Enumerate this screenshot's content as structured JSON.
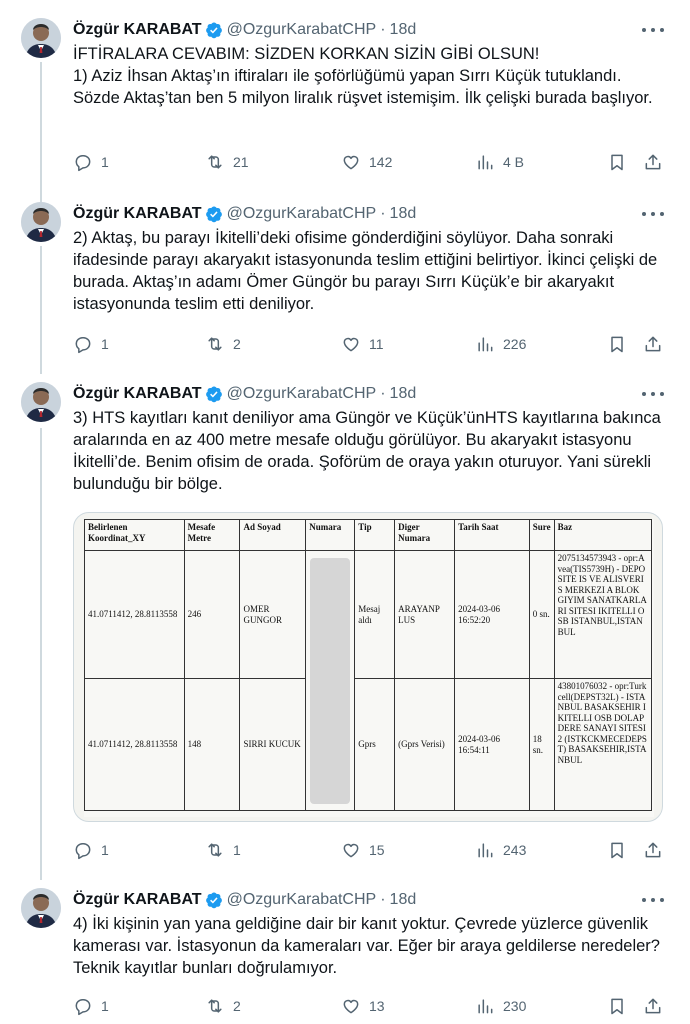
{
  "user": {
    "name": "Özgür KARABAT",
    "handle": "@OzgurKarabatCHP",
    "separator": "·",
    "time": "18d"
  },
  "tweets": [
    {
      "lines": [
        "İFTİRALARA CEVABIM: SİZDEN KORKAN SİZİN GİBİ OLSUN!",
        "1) Aziz İhsan Aktaş’ın iftiraları ile şoförlüğümü yapan Sırrı Küçük tutuklandı. Sözde Aktaş’tan ben 5 milyon liralık rüşvet istemişim. İlk çelişki burada başlıyor."
      ],
      "replies": "1",
      "retweets": "21",
      "likes": "142",
      "views": "4 B"
    },
    {
      "lines": [
        "2) Aktaş, bu parayı İkitelli’deki ofisime gönderdiğini söylüyor. Daha sonraki ifadesinde parayı akaryakıt istasyonunda teslim ettiğini belirtiyor. İkinci çelişki de burada. Aktaş’ın adamı Ömer Güngör bu parayı Sırrı Küçük’e bir akaryakıt istasyonunda teslim etti deniliyor."
      ],
      "replies": "1",
      "retweets": "2",
      "likes": "11",
      "views": "226"
    },
    {
      "lines": [
        "3) HTS kayıtları kanıt deniliyor ama Güngör ve Küçük’ünHTS kayıtlarına bakınca aralarında en az 400 metre mesafe olduğu görülüyor. Bu akaryakıt istasyonu İkitelli’de. Benim ofisim de orada. Şoförüm de oraya yakın oturuyor. Yani sürekli bulunduğu bir bölge."
      ],
      "replies": "1",
      "retweets": "1",
      "likes": "15",
      "views": "243"
    },
    {
      "lines": [
        "4) İki kişinin yan yana geldiğine dair bir kanıt yoktur. Çevrede yüzlerce güvenlik kamerası var. İstasyonun da kameraları var. Eğer bir araya geldilerse neredeler? Teknik kayıtlar bunları doğrulamıyor."
      ],
      "replies": "1",
      "retweets": "2",
      "likes": "13",
      "views": "230"
    }
  ],
  "hts_table": {
    "headers": [
      "Belirlenen Koordinat_XY",
      "Mesafe Metre",
      "Ad Soyad",
      "Numara",
      "Tip",
      "Diger Numara",
      "Tarih Saat",
      "Sure",
      "Baz"
    ],
    "rows": [
      {
        "coord": "41.0711412, 28.8113558",
        "distance": "246",
        "name": "OMER GUNGOR",
        "number": "",
        "type": "Mesaj aldı",
        "other": "ARAYANP LUS",
        "datetime": "2024-03-06 16:52:20",
        "duration": "0 sn.",
        "base": "2075134573943 - opr:Avea(TIS5739H) - DEPOSITE IS VE ALISVERIS MERKEZI A BLOK GIYIM SANATKARLARI SITESI IKITELLI OSB ISTANBUL,ISTANBUL"
      },
      {
        "coord": "41.0711412, 28.8113558",
        "distance": "148",
        "name": "SIRRI KUCUK",
        "number": "",
        "type": "Gprs",
        "other": "(Gprs Verisi)",
        "datetime": "2024-03-06 16:54:11",
        "duration": "18 sn.",
        "base": "43801076032 - opr:Turkcell(DEPST32L) - ISTANBUL BASAKSEHIR IKITELLI OSB DOLAPDERE SANAYI SITESI 2 (ISTKCKMECEDEPST) BASAKSEHIR,ISTANBUL"
      }
    ]
  },
  "colors": {
    "verified": "#1d9bf0",
    "text": "#0f1419",
    "muted": "#536471",
    "line": "#cfd9de"
  },
  "icons": [
    "more-icon",
    "verified-badge-icon",
    "reply-icon",
    "retweet-icon",
    "like-icon",
    "views-icon",
    "bookmark-icon",
    "share-icon"
  ]
}
